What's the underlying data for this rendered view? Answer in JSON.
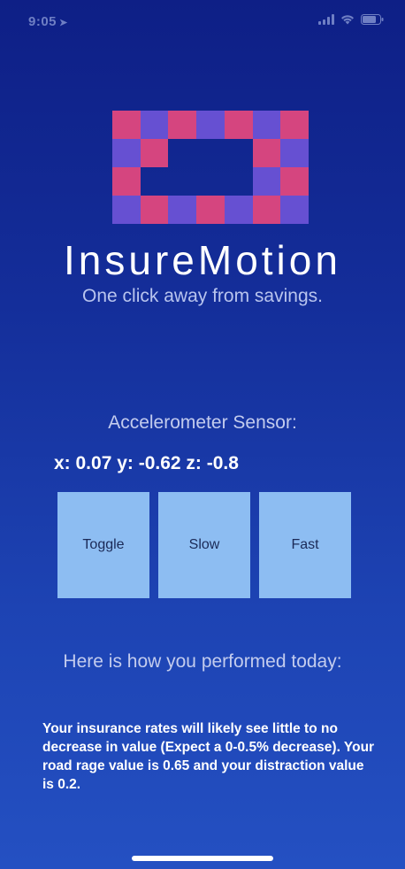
{
  "status_bar": {
    "time": "9:05",
    "location_icon": "location-arrow-icon",
    "signal_icon": "cellular-signal-icon",
    "wifi_icon": "wifi-icon",
    "battery_icon": "battery-icon"
  },
  "logo": {
    "icon": "insuremotion-logo",
    "colors": {
      "pink": "#d5457f",
      "violet": "#6650d2"
    }
  },
  "header": {
    "title": "InsureMotion",
    "tagline": "One click away from savings."
  },
  "sensor": {
    "heading": "Accelerometer Sensor:",
    "readout": "x: 0.07 y: -0.62 z: -0.8"
  },
  "controls": {
    "toggle_label": "Toggle",
    "slow_label": "Slow",
    "fast_label": "Fast",
    "button_color": "#8dbdf2"
  },
  "performance": {
    "heading": "Here is how you performed today:",
    "summary": "Your insurance rates will likely see little to no decrease in value (Expect a 0-0.5% decrease). Your road rage value is 0.65 and your distraction value is 0.2."
  },
  "theme": {
    "background_top": "#0e1f86",
    "background_bottom": "#2450c2"
  }
}
